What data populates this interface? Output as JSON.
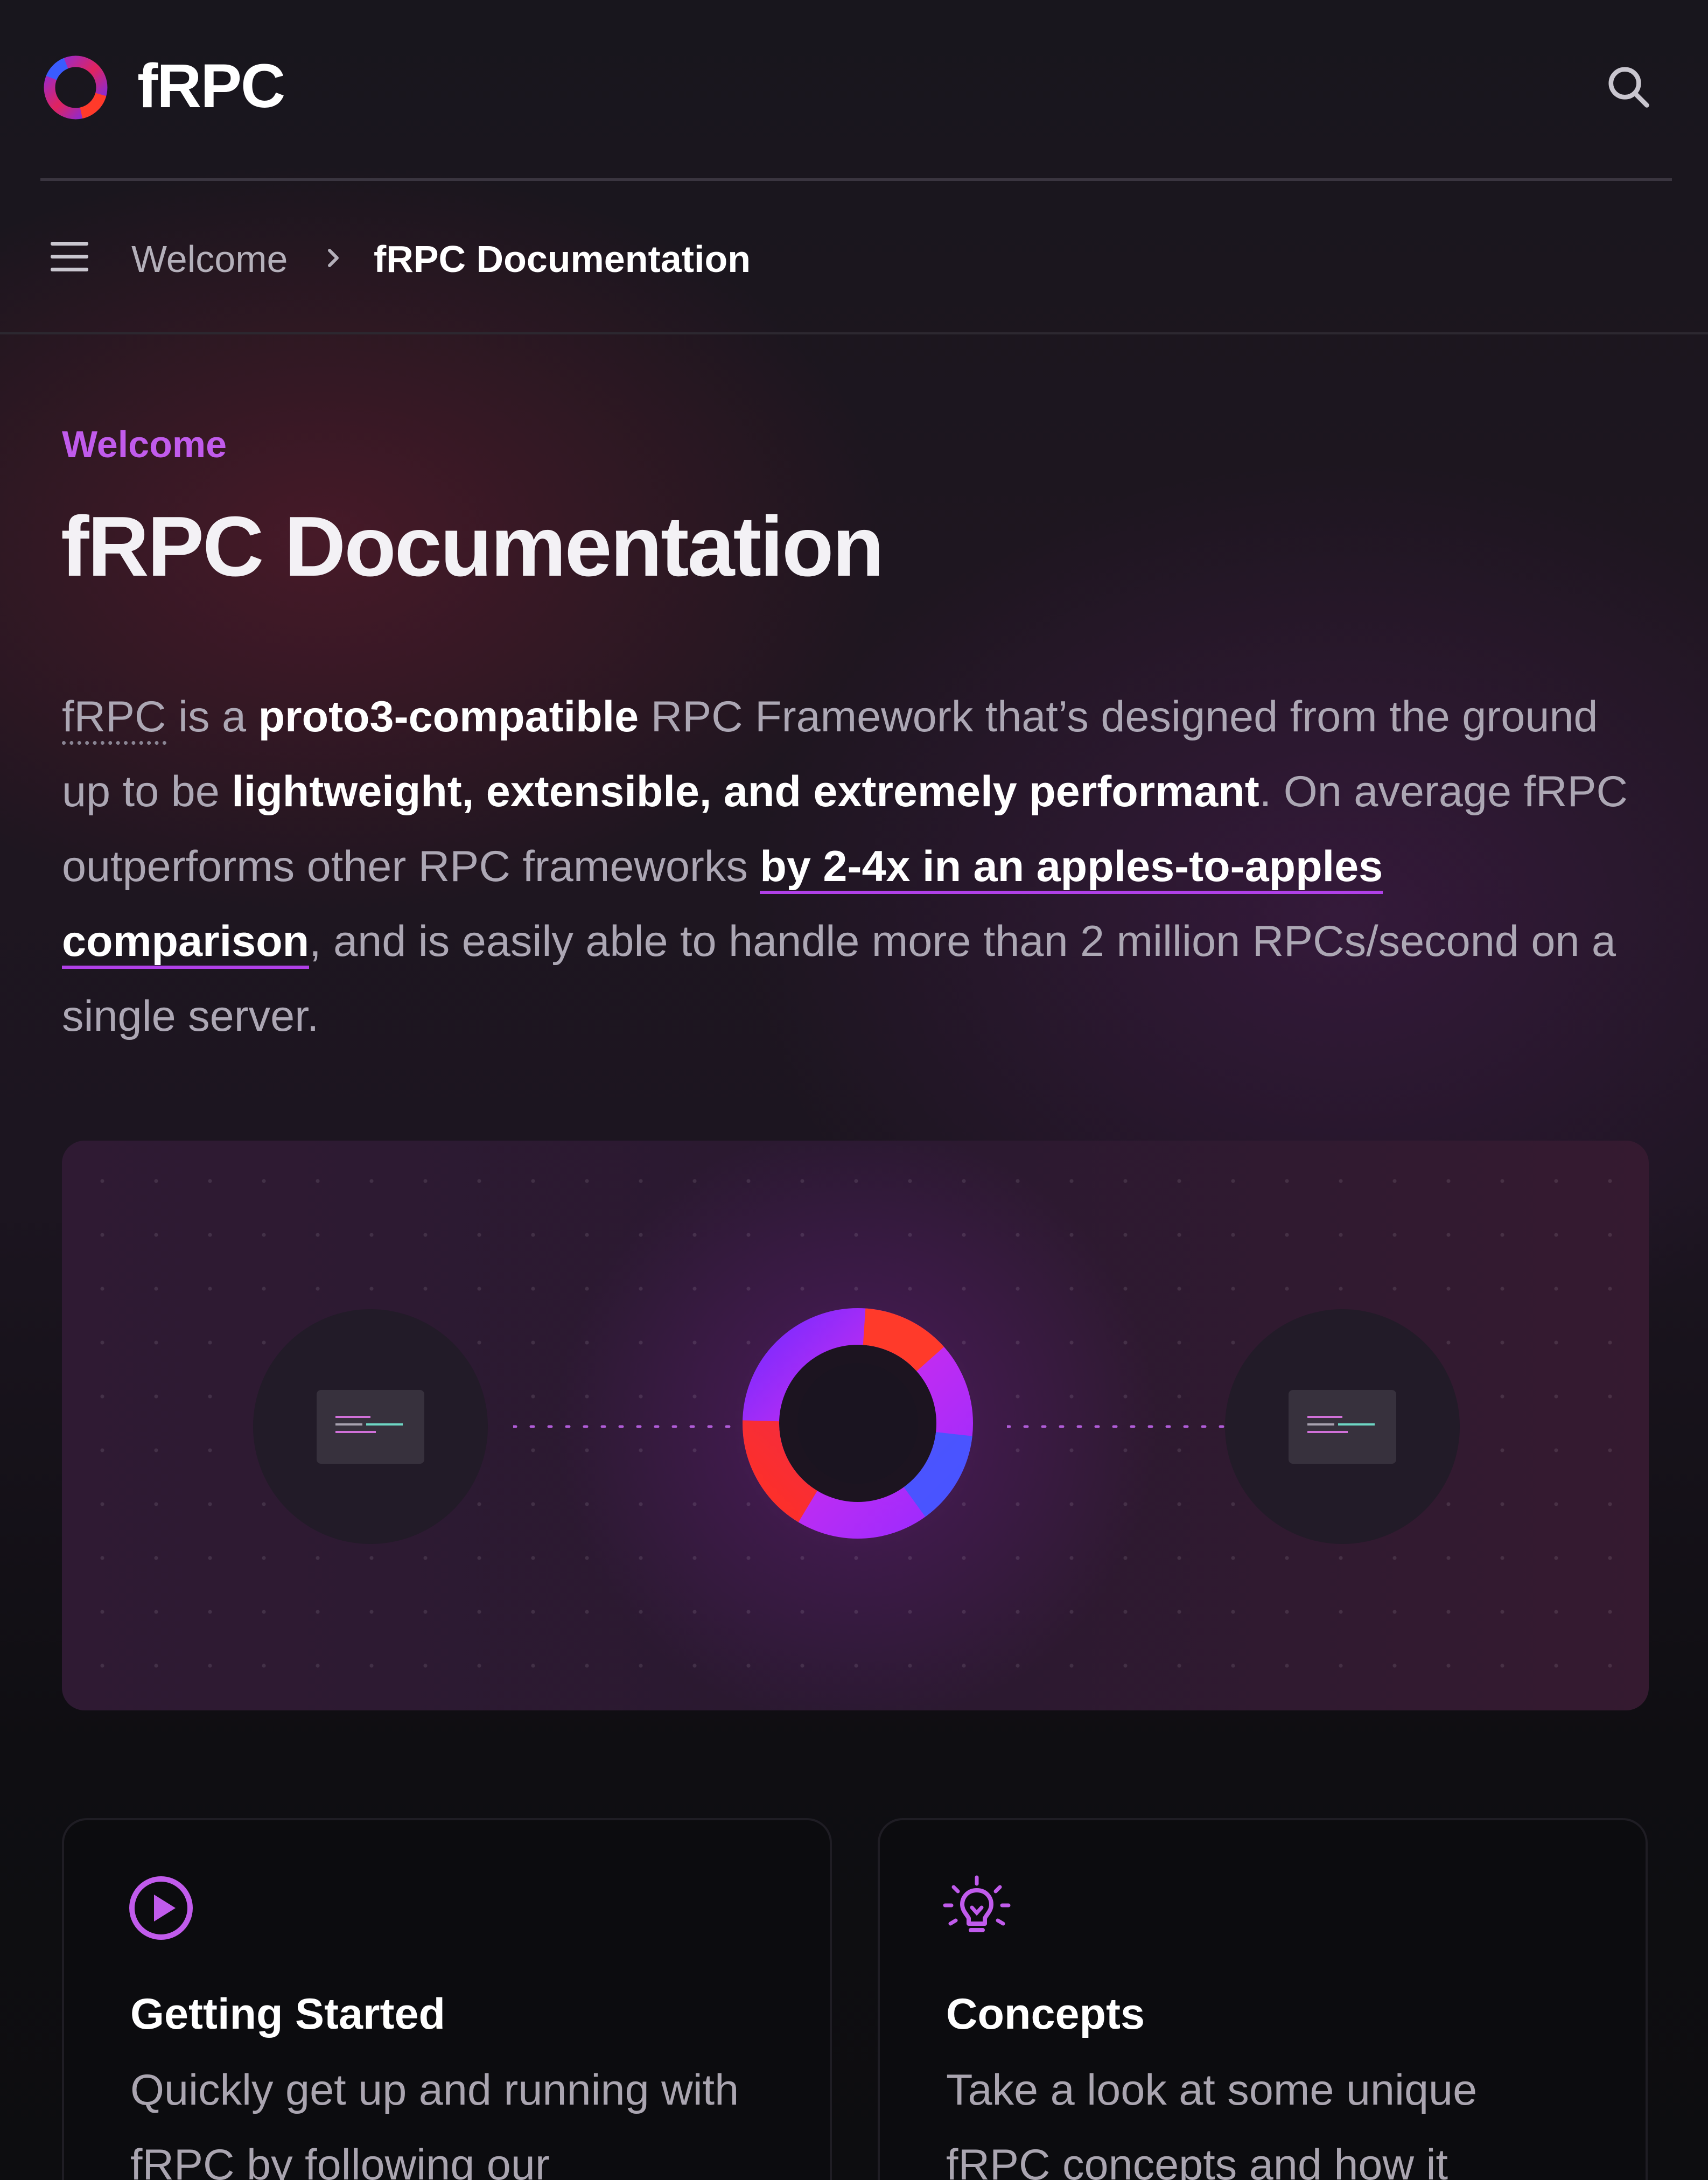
{
  "header": {
    "brand": "fRPC",
    "logo_icon": "frpc-ring-logo-icon",
    "search_icon": "search-icon"
  },
  "breadcrumb": {
    "menu_icon": "hamburger-menu-icon",
    "items": [
      "Welcome",
      "fRPC Documentation"
    ],
    "separator_icon": "chevron-right-icon"
  },
  "main": {
    "eyebrow": "Welcome",
    "title": "fRPC Documentation",
    "intro": {
      "term": "fRPC",
      "t1": " is a ",
      "bold1": "proto3-compatible",
      "t2": " RPC Framework that’s designed from the ground up to be ",
      "bold2": "lightweight, extensible, and extremely performant",
      "t3": ". On average fRPC outperforms other RPC frameworks ",
      "link": "by 2-4x in an apples-to-apples comparison",
      "t4": ", and is easily able to handle more than 2 million RPCs/second on a single server."
    }
  },
  "hero": {
    "left_node_icon": "client-screen-icon",
    "center_icon": "frpc-ring-icon",
    "right_node_icon": "server-screen-icon"
  },
  "cards": [
    {
      "icon": "play-circle-icon",
      "title": "Getting Started",
      "description": "Quickly get up and running with fRPC by following our"
    },
    {
      "icon": "lightbulb-icon",
      "title": "Concepts",
      "description": "Take a look at some unique fRPC concepts and how it"
    }
  ],
  "colors": {
    "accent": "#c15bec",
    "link_underline": "#b040e8",
    "background": "#16141b"
  }
}
